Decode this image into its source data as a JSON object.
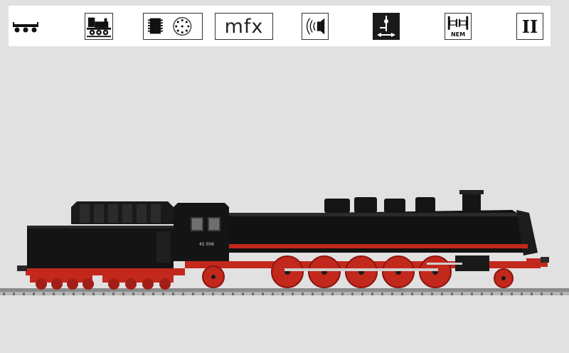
{
  "icon_bar": {
    "icons": [
      {
        "name": "wagon-icon"
      },
      {
        "name": "steam-locomotive-icon"
      },
      {
        "name": "digital-decoder-icon"
      },
      {
        "name": "mfx-icon",
        "label": "mfx"
      },
      {
        "name": "sound-icon"
      },
      {
        "name": "smoke-generator-icon"
      },
      {
        "name": "nem-coupler-icon",
        "label": "NEM"
      },
      {
        "name": "era-icon",
        "label": "II"
      }
    ]
  },
  "product": {
    "loco_number": "45 006"
  },
  "colors": {
    "background": "#e1e1e1",
    "loco_body": "#111111",
    "frame_red": "#c3281d",
    "rail": "#8a8a8a"
  }
}
